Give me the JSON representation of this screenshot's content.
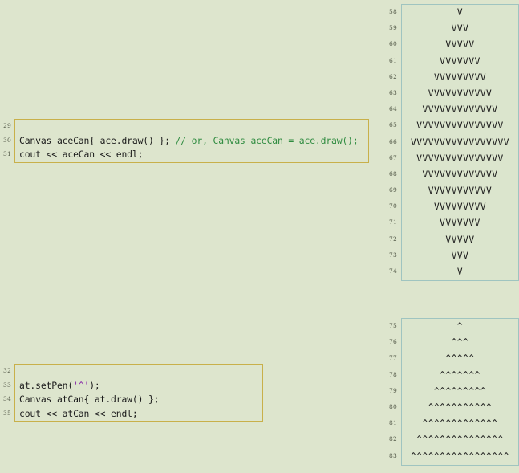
{
  "code_blocks": [
    {
      "name": "ace-canvas-snippet",
      "line_numbers": [
        "29",
        "30",
        "31"
      ],
      "lines": [
        {
          "segments": [
            {
              "text": "",
              "kind": "plain"
            }
          ]
        },
        {
          "segments": [
            {
              "text": "Canvas aceCan{ ace.draw() }; ",
              "kind": "plain"
            },
            {
              "text": "// or, Canvas aceCan = ace.draw();",
              "kind": "comment"
            }
          ]
        },
        {
          "segments": [
            {
              "text": "cout << aceCan << endl;",
              "kind": "plain"
            }
          ]
        }
      ]
    },
    {
      "name": "at-canvas-snippet",
      "line_numbers": [
        "32",
        "33",
        "34",
        "35"
      ],
      "lines": [
        {
          "segments": [
            {
              "text": "",
              "kind": "plain"
            }
          ]
        },
        {
          "segments": [
            {
              "text": "at.setPen(",
              "kind": "plain"
            },
            {
              "text": "'^'",
              "kind": "char"
            },
            {
              "text": ");",
              "kind": "plain"
            }
          ]
        },
        {
          "segments": [
            {
              "text": "Canvas atCan{ at.draw() };",
              "kind": "plain"
            }
          ]
        },
        {
          "segments": [
            {
              "text": "cout << atCan << endl;",
              "kind": "plain"
            }
          ]
        }
      ]
    }
  ],
  "output_panels": [
    {
      "name": "ace-diamond-output",
      "line_numbers": [
        "58",
        "59",
        "60",
        "61",
        "62",
        "63",
        "64",
        "65",
        "66",
        "67",
        "68",
        "69",
        "70",
        "71",
        "72",
        "73",
        "74"
      ],
      "lines": [
        "V",
        "VVV",
        "VVVVV",
        "VVVVVVV",
        "VVVVVVVVV",
        "VVVVVVVVVVV",
        "VVVVVVVVVVVVV",
        "VVVVVVVVVVVVVVV",
        "VVVVVVVVVVVVVVVVV",
        "VVVVVVVVVVVVVVV",
        "VVVVVVVVVVVVV",
        "VVVVVVVVVVV",
        "VVVVVVVVV",
        "VVVVVVV",
        "VVVVV",
        "VVV",
        "V"
      ]
    },
    {
      "name": "at-triangle-output",
      "line_numbers": [
        "75",
        "76",
        "77",
        "78",
        "79",
        "80",
        "81",
        "82",
        "83"
      ],
      "lines": [
        "^",
        "^^^",
        "^^^^^",
        "^^^^^^^",
        "^^^^^^^^^",
        "^^^^^^^^^^^",
        "^^^^^^^^^^^^^",
        "^^^^^^^^^^^^^^^",
        "^^^^^^^^^^^^^^^^^"
      ]
    }
  ],
  "colors": {
    "page_background": "#dde5cd",
    "code_border": "#c8b04a",
    "output_border": "#9fc4c0",
    "comment": "#2e8b3f",
    "char_literal": "#8a2fa8",
    "line_number": "#555b4a",
    "code_text": "#1b1b1b"
  }
}
